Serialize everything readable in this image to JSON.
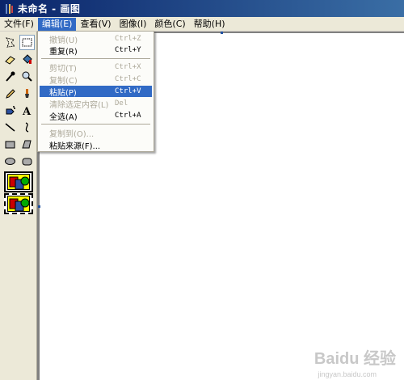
{
  "window": {
    "title": "未命名 - 画图"
  },
  "menubar": {
    "items": [
      {
        "label": "文件(F)"
      },
      {
        "label": "编辑(E)"
      },
      {
        "label": "查看(V)"
      },
      {
        "label": "图像(I)"
      },
      {
        "label": "颜色(C)"
      },
      {
        "label": "帮助(H)"
      }
    ]
  },
  "edit_menu": {
    "items": [
      {
        "label": "撤销(U)",
        "shortcut": "Ctrl+Z",
        "state": "disabled"
      },
      {
        "label": "重复(R)",
        "shortcut": "Ctrl+Y",
        "state": "enabled"
      },
      {
        "label": "剪切(T)",
        "shortcut": "Ctrl+X",
        "state": "disabled"
      },
      {
        "label": "复制(C)",
        "shortcut": "Ctrl+C",
        "state": "disabled"
      },
      {
        "label": "粘贴(P)",
        "shortcut": "Ctrl+V",
        "state": "highlighted"
      },
      {
        "label": "清除选定内容(L)",
        "shortcut": "Del",
        "state": "disabled"
      },
      {
        "label": "全选(A)",
        "shortcut": "Ctrl+A",
        "state": "enabled"
      },
      {
        "label": "复制到(O)...",
        "shortcut": "",
        "state": "disabled"
      },
      {
        "label": "粘贴来源(F)...",
        "shortcut": "",
        "state": "enabled"
      }
    ]
  },
  "toolbox": {
    "tools": [
      "free-form-select-icon",
      "rectangle-select-icon",
      "eraser-icon",
      "fill-bucket-icon",
      "color-picker-icon",
      "magnifier-icon",
      "pencil-icon",
      "brush-icon",
      "airbrush-icon",
      "text-icon",
      "line-icon",
      "curve-icon",
      "rectangle-icon",
      "polygon-icon",
      "ellipse-icon",
      "rounded-rectangle-icon"
    ],
    "selected_tool": "rectangle-select-icon"
  },
  "watermark": {
    "text": "Baidu 经验",
    "url": "jingyan.baidu.com"
  }
}
